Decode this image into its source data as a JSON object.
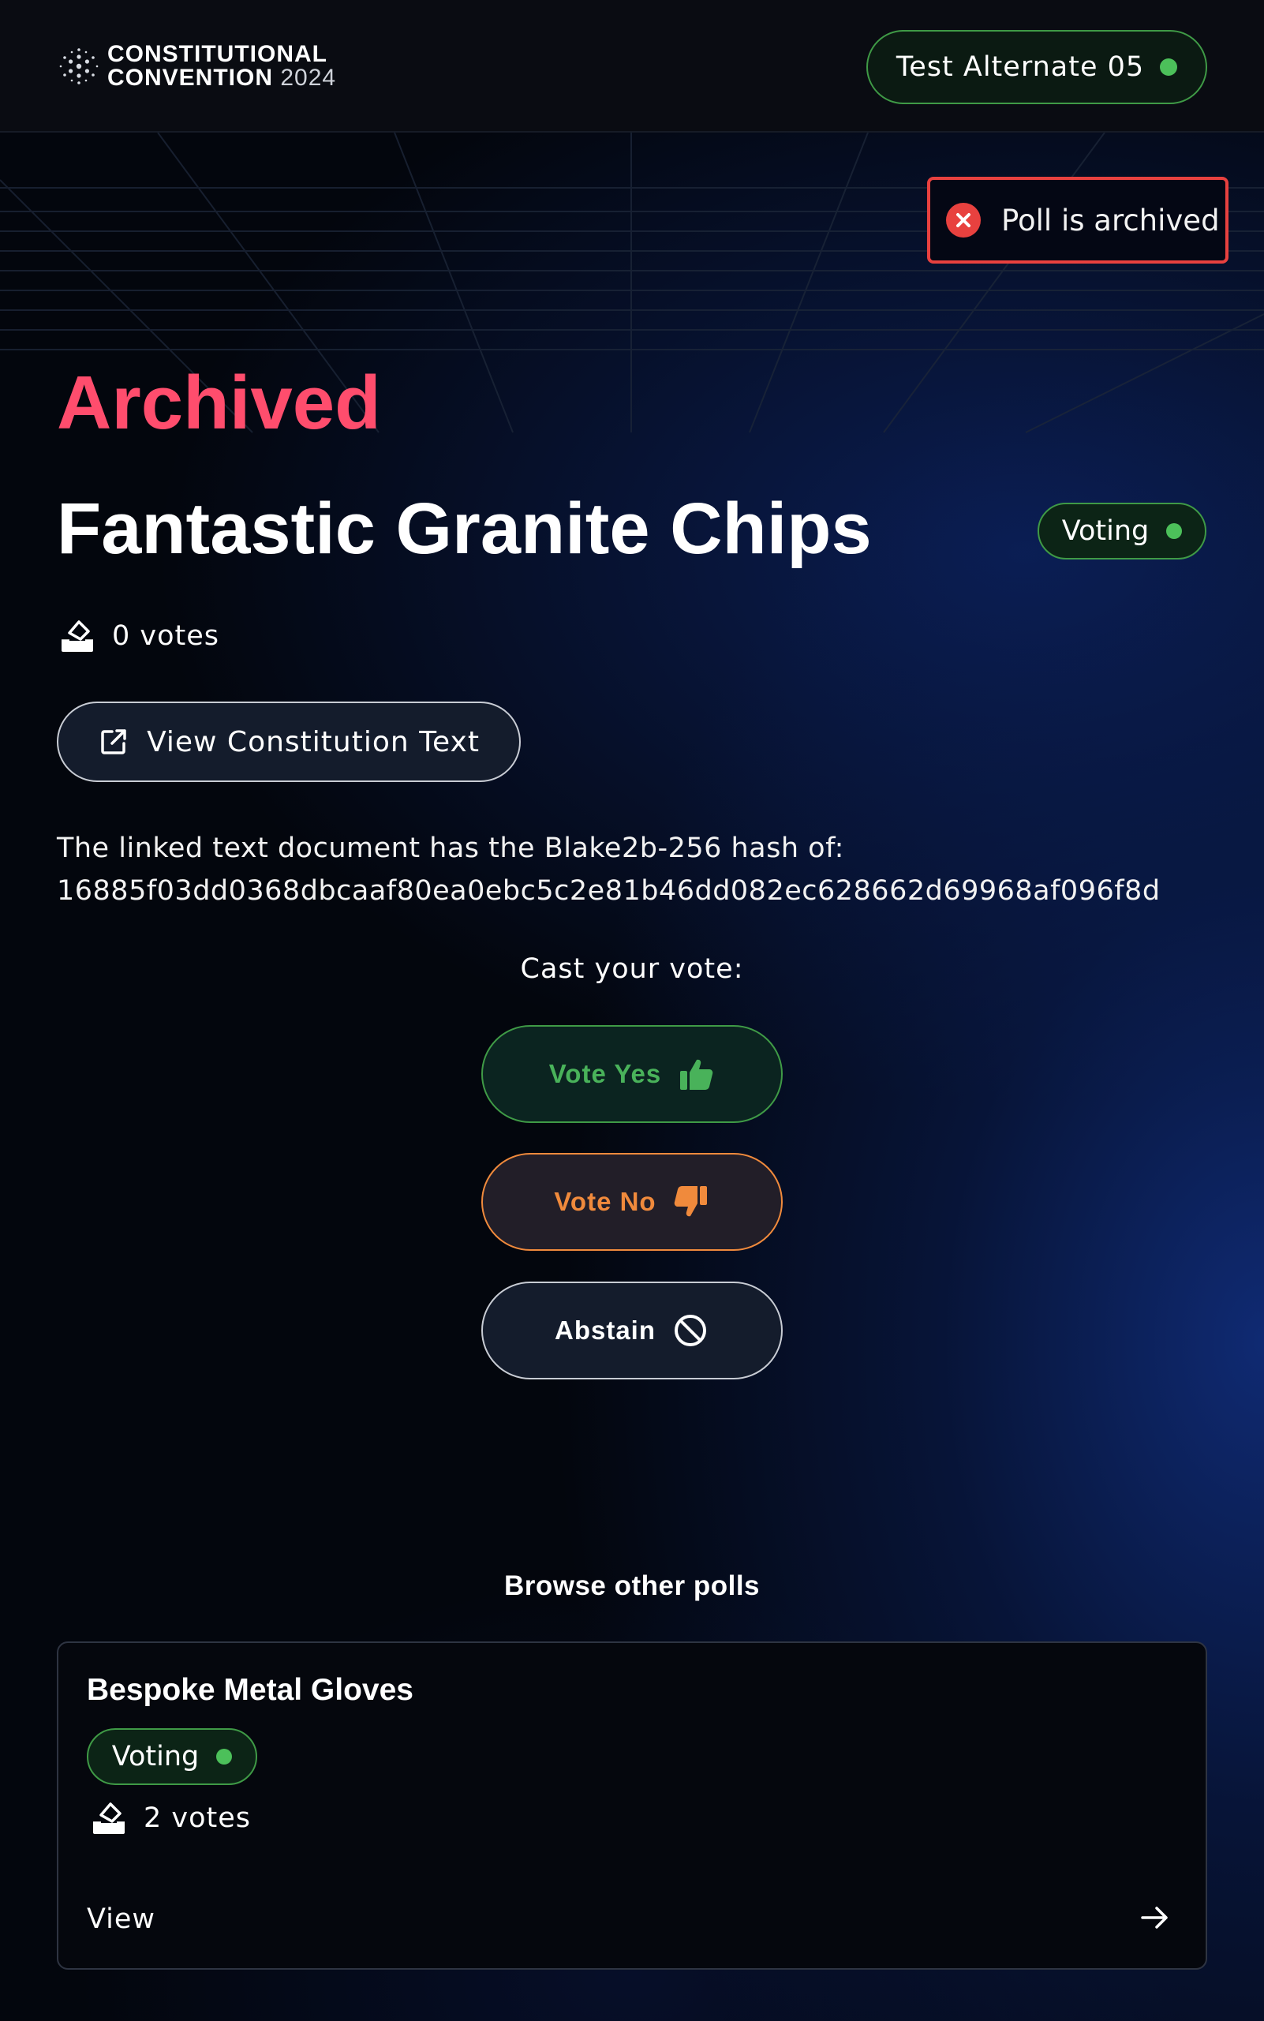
{
  "header": {
    "logo_line1": "CONSTITUTIONAL",
    "logo_line2": "CONVENTION",
    "logo_year": "2024",
    "user_name": "Test Alternate 05"
  },
  "toast": {
    "message": "Poll is archived"
  },
  "poll": {
    "state_label": "Archived",
    "title": "Fantastic Granite Chips",
    "status": "Voting",
    "votes": "0 votes",
    "view_text_button": "View Constitution Text",
    "hash_intro": "The linked text document has the Blake2b-256 hash of:",
    "hash_value": "16885f03dd0368dbcaaf80ea0ebc5c2e81b46dd082ec628662d69968af096f8d"
  },
  "voting": {
    "prompt": "Cast your vote:",
    "yes_label": "Vote Yes",
    "no_label": "Vote No",
    "abstain_label": "Abstain"
  },
  "browse": {
    "heading": "Browse other polls",
    "polls": [
      {
        "title": "Bespoke Metal Gloves",
        "status": "Voting",
        "votes": "2 votes",
        "view_label": "View"
      }
    ]
  },
  "colors": {
    "archived": "#ff4d6d",
    "status_green": "#4cc05a",
    "vote_yes": "#49b25a",
    "vote_no": "#f08a3c",
    "error": "#e8413f"
  }
}
